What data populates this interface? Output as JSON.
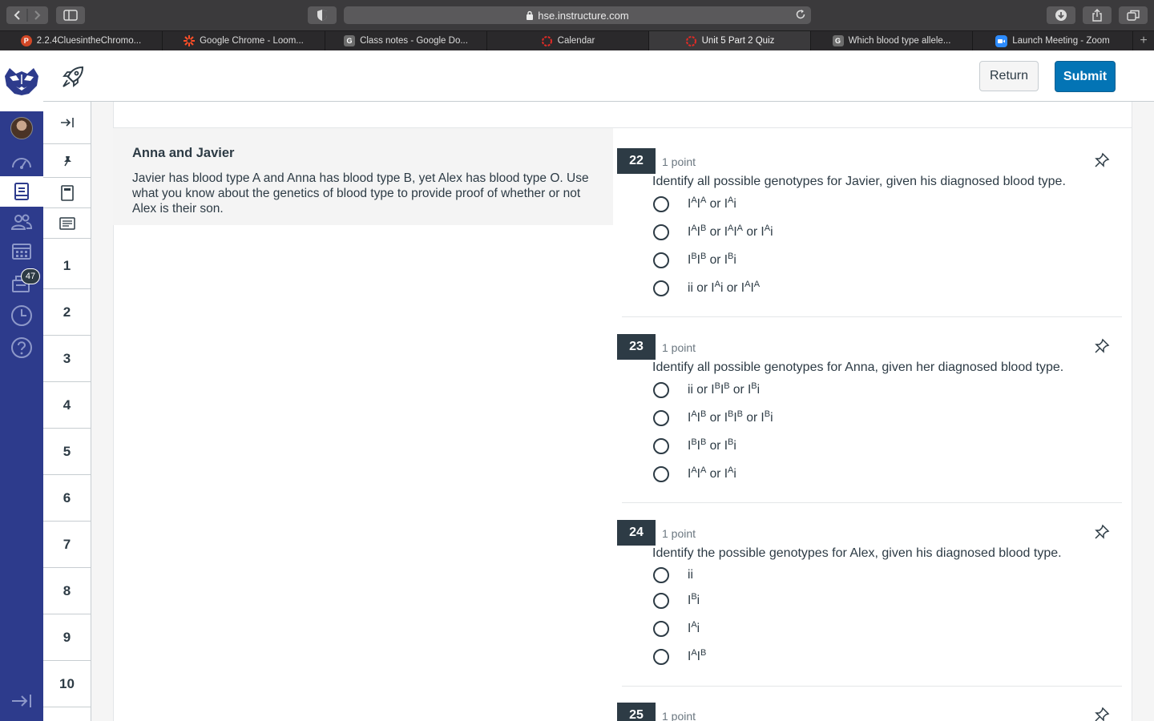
{
  "browser": {
    "url": "hse.instructure.com",
    "tabs": [
      {
        "label": "2.2.4CluesintheChromo...",
        "favicon": "P",
        "color": "#d24726",
        "active": false
      },
      {
        "label": "Google Chrome - Loom...",
        "favicon": "loom-icon",
        "color": "#fd4e27",
        "active": false
      },
      {
        "label": "Class notes - Google Do...",
        "favicon": "G",
        "color": "#6d6d6d",
        "active": false
      },
      {
        "label": "Calendar",
        "favicon": "calendar-icon",
        "color": "#e12b26",
        "active": false
      },
      {
        "label": "Unit 5 Part 2 Quiz",
        "favicon": "canvas-icon",
        "color": "#e12b26",
        "active": true
      },
      {
        "label": "Which blood type allele...",
        "favicon": "G",
        "color": "#6d6d6d",
        "active": false
      },
      {
        "label": "Launch Meeting - Zoom",
        "favicon": "zoom-icon",
        "color": "#2d8cff",
        "active": false
      }
    ]
  },
  "global_nav": {
    "inbox_badge": "47",
    "brand_color": "#2d3b8c"
  },
  "header": {
    "return_label": "Return",
    "submit_label": "Submit",
    "submit_color": "#0374b5"
  },
  "question_nav": {
    "numbers": [
      "1",
      "2",
      "3",
      "4",
      "5",
      "6",
      "7",
      "8",
      "9",
      "10"
    ]
  },
  "stimulus": {
    "title": "Anna and Javier",
    "body": "Javier has blood type A and Anna has blood type B, yet Alex has blood type O. Use what you know about the genetics of blood type to provide proof of whether or not Alex is their son."
  },
  "questions": [
    {
      "number": "22",
      "points": "1 point",
      "text": "Identify all possible genotypes for Javier, given his diagnosed blood type.",
      "options": [
        [
          [
            "I",
            ""
          ],
          [
            "A",
            "sup"
          ],
          [
            "I",
            ""
          ],
          [
            "A",
            "sup"
          ],
          [
            " or I",
            ""
          ],
          [
            "A",
            "sup"
          ],
          [
            "i",
            ""
          ]
        ],
        [
          [
            "I",
            ""
          ],
          [
            "A",
            "sup"
          ],
          [
            "I",
            ""
          ],
          [
            "B",
            "sup"
          ],
          [
            " or I",
            ""
          ],
          [
            "A",
            "sup"
          ],
          [
            "I",
            ""
          ],
          [
            "A",
            "sup"
          ],
          [
            " or I",
            ""
          ],
          [
            "A",
            "sup"
          ],
          [
            "i",
            ""
          ]
        ],
        [
          [
            "I",
            ""
          ],
          [
            "B",
            "sup"
          ],
          [
            "I",
            ""
          ],
          [
            "B",
            "sup"
          ],
          [
            " or I",
            ""
          ],
          [
            "B",
            "sup"
          ],
          [
            "i",
            ""
          ]
        ],
        [
          [
            "ii or I",
            ""
          ],
          [
            "A",
            "sup"
          ],
          [
            "i or I",
            ""
          ],
          [
            "A",
            "sup"
          ],
          [
            "I",
            ""
          ],
          [
            "A",
            "sup"
          ]
        ]
      ]
    },
    {
      "number": "23",
      "points": "1 point",
      "text": "Identify all possible genotypes for Anna, given her diagnosed blood type.",
      "options": [
        [
          [
            "ii or I",
            ""
          ],
          [
            "B",
            "sup"
          ],
          [
            "I",
            ""
          ],
          [
            "B",
            "sup"
          ],
          [
            " or I",
            ""
          ],
          [
            "B",
            "sup"
          ],
          [
            "i",
            ""
          ]
        ],
        [
          [
            "I",
            ""
          ],
          [
            "A",
            "sup"
          ],
          [
            "I",
            ""
          ],
          [
            "B",
            "sup"
          ],
          [
            " or I",
            ""
          ],
          [
            "B",
            "sup"
          ],
          [
            "I",
            ""
          ],
          [
            "B",
            "sup"
          ],
          [
            " or I",
            ""
          ],
          [
            "B",
            "sup"
          ],
          [
            "i",
            ""
          ]
        ],
        [
          [
            "I",
            ""
          ],
          [
            "B",
            "sup"
          ],
          [
            "I",
            ""
          ],
          [
            "B",
            "sup"
          ],
          [
            " or I",
            ""
          ],
          [
            "B",
            "sup"
          ],
          [
            "i",
            ""
          ]
        ],
        [
          [
            "I",
            ""
          ],
          [
            "A",
            "sup"
          ],
          [
            "I",
            ""
          ],
          [
            "A",
            "sup"
          ],
          [
            " or I",
            ""
          ],
          [
            "A",
            "sup"
          ],
          [
            "i",
            ""
          ]
        ]
      ]
    },
    {
      "number": "24",
      "points": "1 point",
      "text": "Identify the possible genotypes for Alex, given his diagnosed blood type.",
      "options": [
        [
          [
            "ii",
            ""
          ]
        ],
        [
          [
            "I",
            ""
          ],
          [
            "B",
            "sup"
          ],
          [
            "i",
            ""
          ]
        ],
        [
          [
            "I",
            ""
          ],
          [
            "A",
            "sup"
          ],
          [
            "i",
            ""
          ]
        ],
        [
          [
            "I",
            ""
          ],
          [
            "A",
            "sup"
          ],
          [
            "I",
            ""
          ],
          [
            "B",
            "sup"
          ]
        ]
      ]
    },
    {
      "number": "25",
      "points": "1 point",
      "text": "",
      "options": []
    }
  ]
}
